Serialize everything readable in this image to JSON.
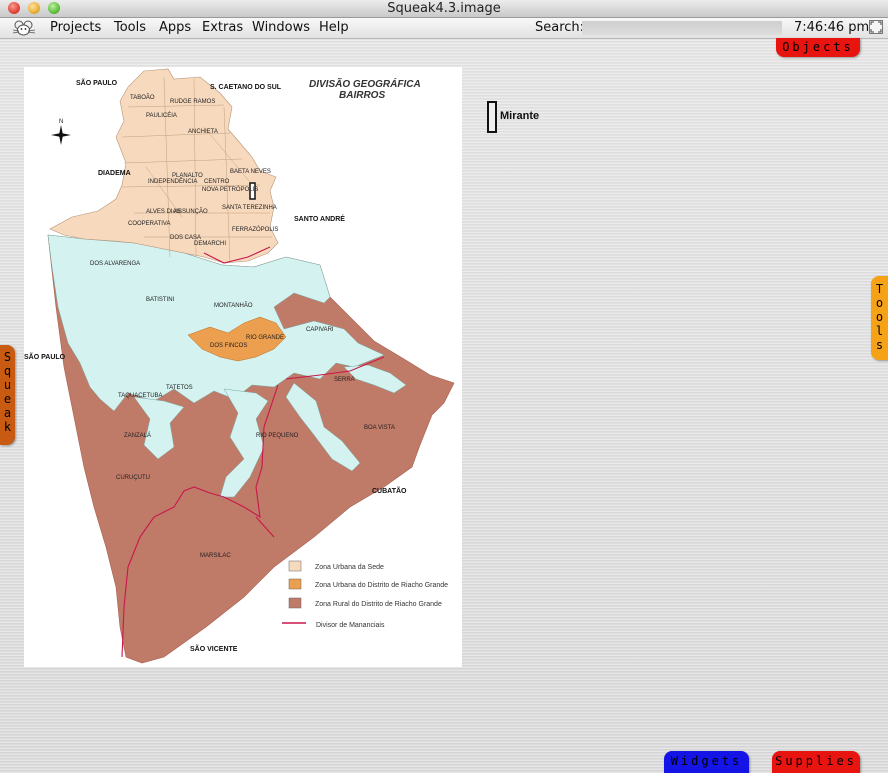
{
  "window": {
    "title": "Squeak4.3.image"
  },
  "menubar": {
    "items": [
      "Projects",
      "Tools",
      "Apps",
      "Extras",
      "Windows",
      "Help"
    ],
    "search_label": "Search:",
    "search_value": "",
    "clock": "7:46:46 pm"
  },
  "flaps": {
    "objects": "Objects",
    "tools": [
      "T",
      "o",
      "o",
      "l",
      "s"
    ],
    "squeak": [
      "S",
      "q",
      "u",
      "e",
      "a",
      "k"
    ],
    "widgets": "Widgets",
    "supplies": "Supplies"
  },
  "morphs": {
    "mirante": "Mirante"
  },
  "map": {
    "title_line1": "DIVISÃO GEOGRÁFICA",
    "title_line2": "BAIRROS",
    "neighbor_labels": {
      "sao_paulo_top": "SÃO PAULO",
      "sao_caetano": "S. CAETANO DO SUL",
      "diadema": "DIADEMA",
      "santo_andre": "SANTO ANDRÉ",
      "sao_paulo_left": "SÃO PAULO",
      "cubatao": "CUBATÃO",
      "sao_vicente": "SÃO VICENTE"
    },
    "district_labels": [
      "TABOÃO",
      "RUDGE RAMOS",
      "PAULICÉIA",
      "ANCHIETA",
      "BAETA NEVES",
      "CENTRO",
      "PLANALTO",
      "INDEPENDÊNCIA",
      "NOVA PETRÓPOLIS",
      "ALVES DIAS",
      "ASSUNÇÃO",
      "SANTA TEREZINHA",
      "COOPERATIVA",
      "DOS CASA",
      "DEMARCHI",
      "FERRAZÓPOLIS",
      "BATISTINI",
      "DOS ALVARENGA",
      "MONTANHÃO",
      "RIO GRANDE",
      "CAPIVARI",
      "TATETOS",
      "TAQUACETUBA",
      "ZANZALÁ",
      "RIO PEQUENO",
      "CURUÇUTU",
      "BOA VISTA",
      "SERRA",
      "MARSILAC",
      "DOS FINCOS"
    ],
    "legend": [
      {
        "label": "Zona Urbana da Sede",
        "color": "#f7d9bd"
      },
      {
        "label": "Zona Urbana do Distrito de Riacho Grande",
        "color": "#ec9f4e"
      },
      {
        "label": "Zona Rural do Distrito de Riacho Grande",
        "color": "#c07a68"
      },
      {
        "label": "Divisor de Mananciais",
        "color": "#c8174b"
      }
    ]
  },
  "colors": {
    "urban": "#f7d9bd",
    "riacho_urban": "#ec9f4e",
    "rural": "#c07a68",
    "water": "#d4f3f0",
    "divisor": "#c8174b",
    "objects_flap": "#e8140f",
    "tools_flap": "#f5a217",
    "squeak_flap": "#c85a12",
    "widgets_flap": "#1414e6",
    "supplies_flap": "#e8140f"
  }
}
